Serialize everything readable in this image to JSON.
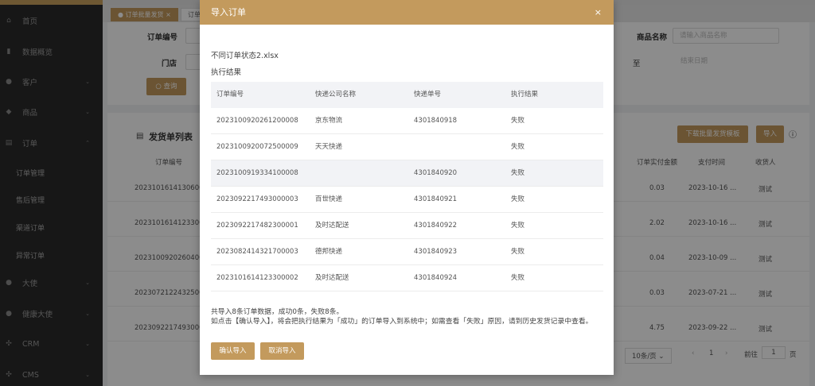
{
  "sidebar": {
    "items": [
      {
        "label": "首页",
        "icon": "home-icon"
      },
      {
        "label": "数据概览",
        "icon": "chart-icon"
      },
      {
        "label": "客户",
        "icon": "user-icon"
      },
      {
        "label": "商品",
        "icon": "diamond-icon"
      },
      {
        "label": "订单",
        "icon": "order-icon"
      },
      {
        "label": "大使",
        "icon": "person-icon"
      },
      {
        "label": "健康大使",
        "icon": "person-icon"
      },
      {
        "label": "CRM",
        "icon": "grid-icon"
      },
      {
        "label": "CMS",
        "icon": "grid-icon"
      }
    ],
    "sub_items": [
      "订单管理",
      "售后管理",
      "渠道订单",
      "异常订单"
    ]
  },
  "tabs": {
    "active": "订单批量发货",
    "second": "订单"
  },
  "filters": {
    "order_no_label": "订单编号",
    "store_label": "门店",
    "product_label": "商品名称",
    "product_placeholder": "请输入商品名称",
    "to_label": "至",
    "end_date_placeholder": "结束日期",
    "search_button": "查询"
  },
  "list": {
    "title": "发货单列表",
    "download_button": "下载批量发货模板",
    "import_button": "导入",
    "col_order_no": "订单编号",
    "col_amount": "订单实付金额",
    "col_pay_time": "支付时间",
    "col_receiver": "收货人",
    "rows": [
      {
        "order": "20231016141306000",
        "amount": "0.03",
        "time": "2023-10-16 ...",
        "receiver": "测试"
      },
      {
        "order": "20231016141233000",
        "amount": "2.02",
        "time": "2023-10-16 ...",
        "receiver": "测试"
      },
      {
        "order": "20231009202604000",
        "amount": "0.04",
        "time": "2023-10-09 ...",
        "receiver": "测试"
      },
      {
        "order": "20230721224325000",
        "amount": "0.03",
        "time": "2023-07-21 ...",
        "receiver": "测试"
      },
      {
        "order": "20230922174930000",
        "amount": "4.75",
        "time": "2023-09-22 ...",
        "receiver": "测试"
      }
    ],
    "page_size": "10条/页",
    "page_current": "1",
    "goto_label": "前往",
    "goto_value": "1",
    "page_unit": "页"
  },
  "modal": {
    "title": "导入订单",
    "close_glyph": "×",
    "file_name": "不同订单状态2.xlsx",
    "result_label": "执行结果",
    "columns": [
      "订单编号",
      "快递公司名称",
      "快递单号",
      "执行结果"
    ],
    "rows": [
      {
        "order_no": "2023100920261200008",
        "courier": "京东物流",
        "tracking": "4301840918",
        "result": "失败"
      },
      {
        "order_no": "2023100920072500009",
        "courier": "天天快递",
        "tracking": "",
        "result": "失败"
      },
      {
        "order_no": "2023100919334100008",
        "courier": "",
        "tracking": "4301840920",
        "result": "失败"
      },
      {
        "order_no": "2023092217493000003",
        "courier": "百世快递",
        "tracking": "4301840921",
        "result": "失败"
      },
      {
        "order_no": "2023092217482300001",
        "courier": "及时达配送",
        "tracking": "4301840922",
        "result": "失败"
      },
      {
        "order_no": "2023082414321700003",
        "courier": "德邦快递",
        "tracking": "4301840923",
        "result": "失败"
      },
      {
        "order_no": "2023101614123300002",
        "courier": "及时达配送",
        "tracking": "4301840924",
        "result": "失败"
      }
    ],
    "summary_line1": "共导入8条订单数据，成功0条，失败8条。",
    "summary_line2": "如点击【确认导入】，将会把执行结果为「成功」的订单导入到系统中；如需查看「失败」原因，请到历史发货记录中查看。",
    "confirm_button": "确认导入",
    "cancel_button": "取消导入"
  },
  "colors": {
    "accent": "#c39a5d",
    "sidebar_bg": "#2b2b2b"
  }
}
